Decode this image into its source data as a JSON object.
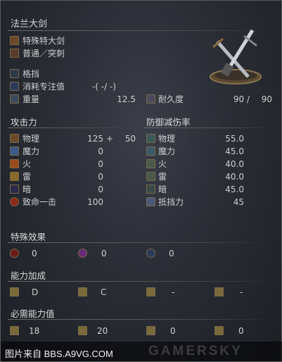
{
  "weapon": {
    "name": "法兰大剑",
    "type": "特殊特大剑",
    "attack_type": "普通／突刺",
    "skill": "格挡",
    "fp_cost_label": "消耗专注值",
    "fp_cost_value": "-(  -/  -)",
    "weight_label": "重量",
    "weight_value": "12.5",
    "durability_label": "耐久度",
    "durability_value": "90 /",
    "durability_max": "90"
  },
  "attack": {
    "header": "攻击力",
    "rows": [
      {
        "label": "物理",
        "value": "125",
        "bonus": "+",
        "extra": "50"
      },
      {
        "label": "魔力",
        "value": "0"
      },
      {
        "label": "火",
        "value": "0"
      },
      {
        "label": "雷",
        "value": "0"
      },
      {
        "label": "暗",
        "value": "0"
      },
      {
        "label": "致命一击",
        "value": "100"
      }
    ]
  },
  "defense": {
    "header": "防御减伤率",
    "rows": [
      {
        "label": "物理",
        "value": "55.0"
      },
      {
        "label": "魔力",
        "value": "45.0"
      },
      {
        "label": "火",
        "value": "40.0"
      },
      {
        "label": "雷",
        "value": "40.0"
      },
      {
        "label": "暗",
        "value": "45.0"
      },
      {
        "label": "抵挡力",
        "value": "45"
      }
    ]
  },
  "special": {
    "header": "特殊效果",
    "values": [
      "0",
      "0",
      "0"
    ]
  },
  "scaling": {
    "header": "能力加成",
    "values": [
      "D",
      "C",
      "-",
      "-"
    ]
  },
  "requirements": {
    "header": "必需能力值",
    "values": [
      "18",
      "20",
      "0",
      "0"
    ]
  },
  "watermark": {
    "left": "图片来自 BBS.A9VG.COM",
    "right": "GAMERSKY"
  },
  "colors": {
    "accent_line": "#6b6b6b",
    "text": "#cfcfcf"
  }
}
